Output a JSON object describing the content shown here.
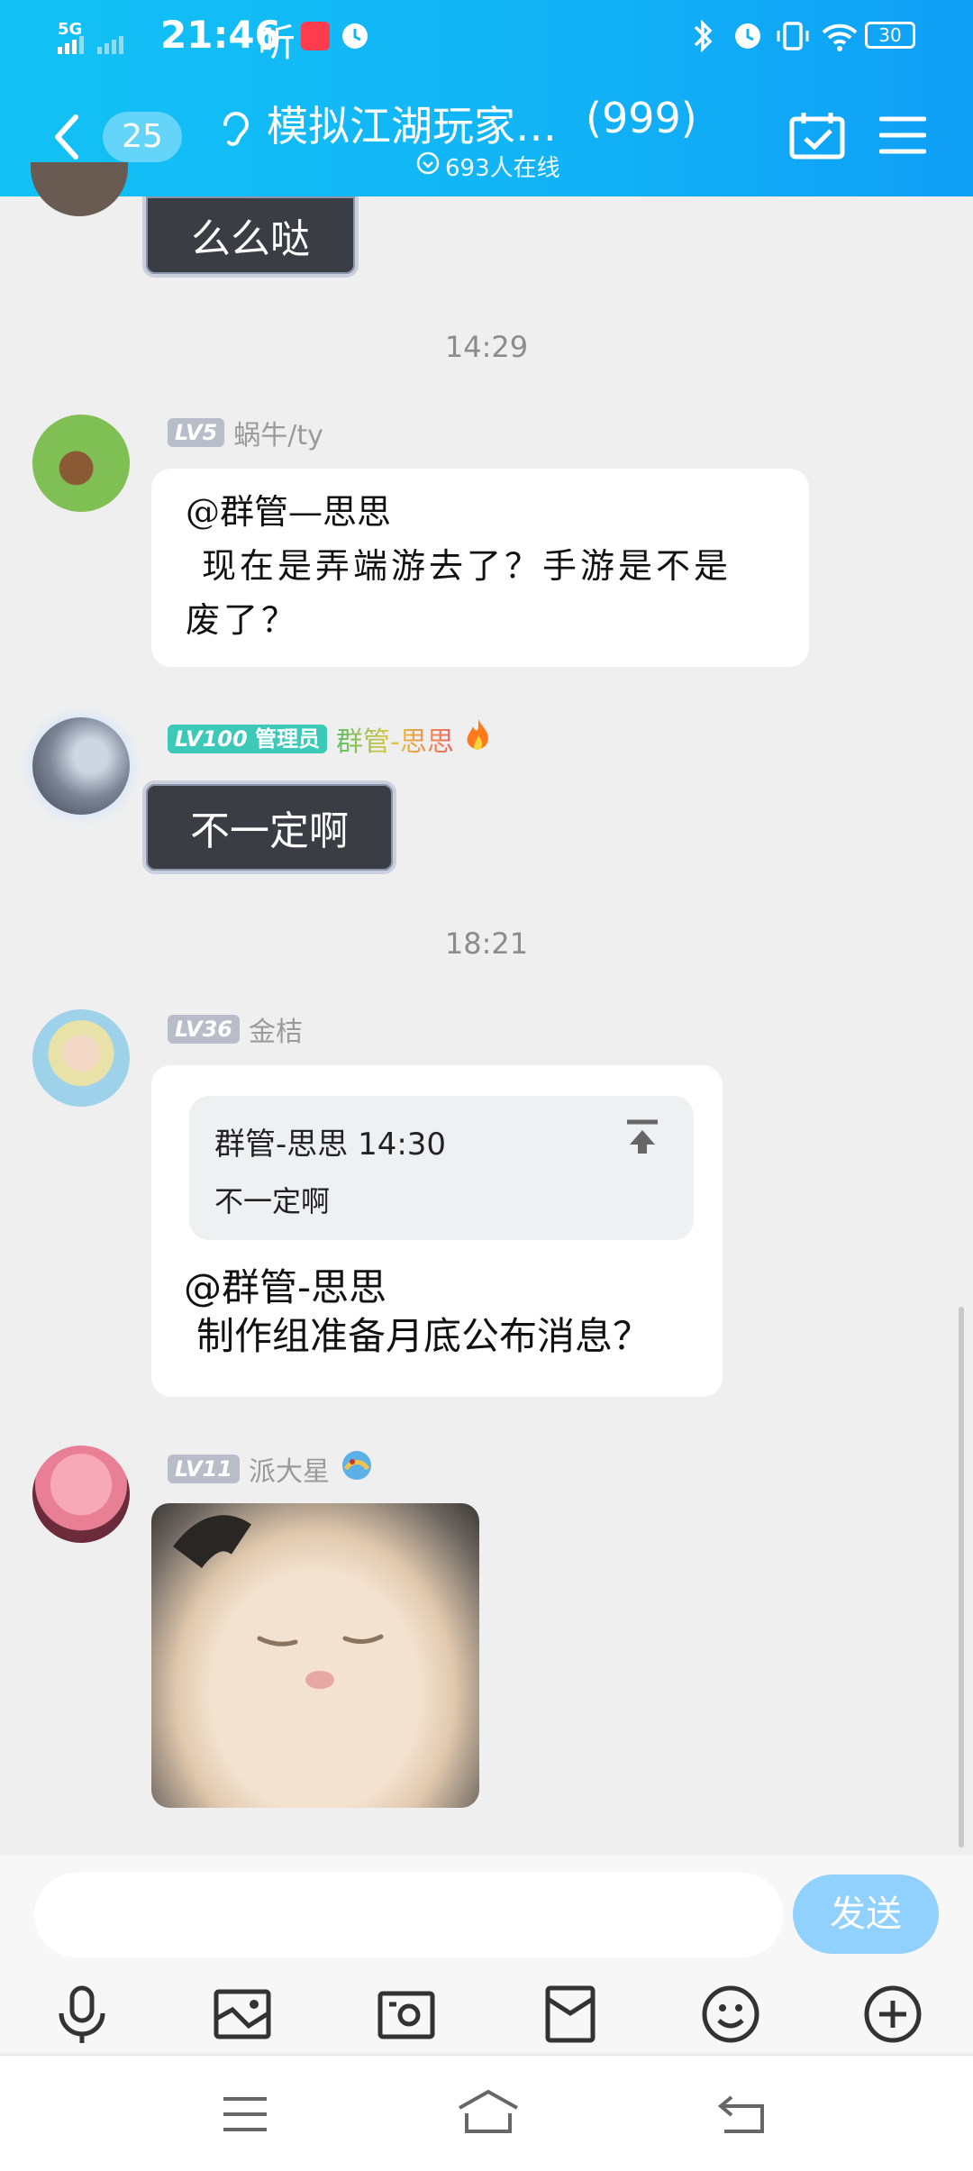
{
  "status_bar": {
    "network": "5G",
    "time": "21:46",
    "app_label": "听",
    "battery": "30"
  },
  "header": {
    "back_count": "25",
    "group_title": "模拟江湖玩家…",
    "member_count": "(999)",
    "online_text": "693人在线"
  },
  "messages": [
    {
      "type": "sticker_text",
      "text": "么么哒"
    },
    {
      "type": "time",
      "text": "14:29"
    },
    {
      "type": "text",
      "level": "LV5",
      "sender": "蜗牛/ty",
      "lines": [
        "@群管—思思",
        "现在是弄端游去了？手游是不是",
        "废了？"
      ]
    },
    {
      "type": "sticker_text",
      "level": "LV100",
      "role": "管理员",
      "sender": "群管-思思",
      "text": "不一定啊"
    },
    {
      "type": "time",
      "text": "18:21"
    },
    {
      "type": "reply",
      "level": "LV36",
      "sender": "金桔",
      "quote_header": "群管-思思 14:30",
      "quote_text": "不一定啊",
      "lines": [
        "@群管-思思",
        "制作组准备月底公布消息？"
      ]
    },
    {
      "type": "image",
      "level": "LV11",
      "sender": "派大星"
    }
  ],
  "input": {
    "placeholder": "",
    "send_label": "发送"
  },
  "toolbar": [
    "microphone-icon",
    "image-icon",
    "camera-icon",
    "redpacket-icon",
    "emoji-icon",
    "plus-icon"
  ],
  "colors": {
    "header_start": "#12c2f5",
    "header_end": "#0f9ff6",
    "send": "#90d1ff",
    "admin": "#3cc9b7"
  }
}
